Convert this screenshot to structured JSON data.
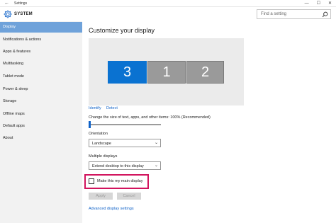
{
  "window": {
    "back_glyph": "←",
    "title": "Settings",
    "minimize_glyph": "—",
    "maximize_glyph": "☐",
    "close_glyph": "✕"
  },
  "header": {
    "title": "SYSTEM",
    "icon": "gear-icon"
  },
  "search": {
    "placeholder": "Find a setting",
    "icon": "search-icon"
  },
  "sidebar": {
    "items": [
      {
        "label": "Display",
        "active": true
      },
      {
        "label": "Notifications & actions",
        "active": false
      },
      {
        "label": "Apps & features",
        "active": false
      },
      {
        "label": "Multitasking",
        "active": false
      },
      {
        "label": "Tablet mode",
        "active": false
      },
      {
        "label": "Power & sleep",
        "active": false
      },
      {
        "label": "Storage",
        "active": false
      },
      {
        "label": "Offline maps",
        "active": false
      },
      {
        "label": "Default apps",
        "active": false
      },
      {
        "label": "About",
        "active": false
      }
    ]
  },
  "main": {
    "title": "Customize your display",
    "monitors": [
      {
        "label": "3",
        "selected": true
      },
      {
        "label": "1",
        "selected": false
      },
      {
        "label": "2",
        "selected": false
      }
    ],
    "identify_label": "Identify",
    "detect_label": "Detect",
    "scale_label": "Change the size of text, apps, and other items: 100% (Recommended)",
    "scale_value_percent": 100,
    "orientation_label": "Orientation",
    "orientation_value": "Landscape",
    "multiple_displays_label": "Multiple displays",
    "multiple_displays_value": "Extend desktop to this display",
    "main_display_checkbox_label": "Make this my main display",
    "main_display_checked": false,
    "apply_label": "Apply",
    "cancel_label": "Cancel",
    "advanced_link": "Advanced display settings"
  },
  "colors": {
    "accent": "#0f62c8",
    "sidebar_active": "#6fa2da",
    "monitor_selected": "#0a72d1",
    "monitor_idle": "#9a9a9a",
    "highlight_box": "#d2145e"
  }
}
